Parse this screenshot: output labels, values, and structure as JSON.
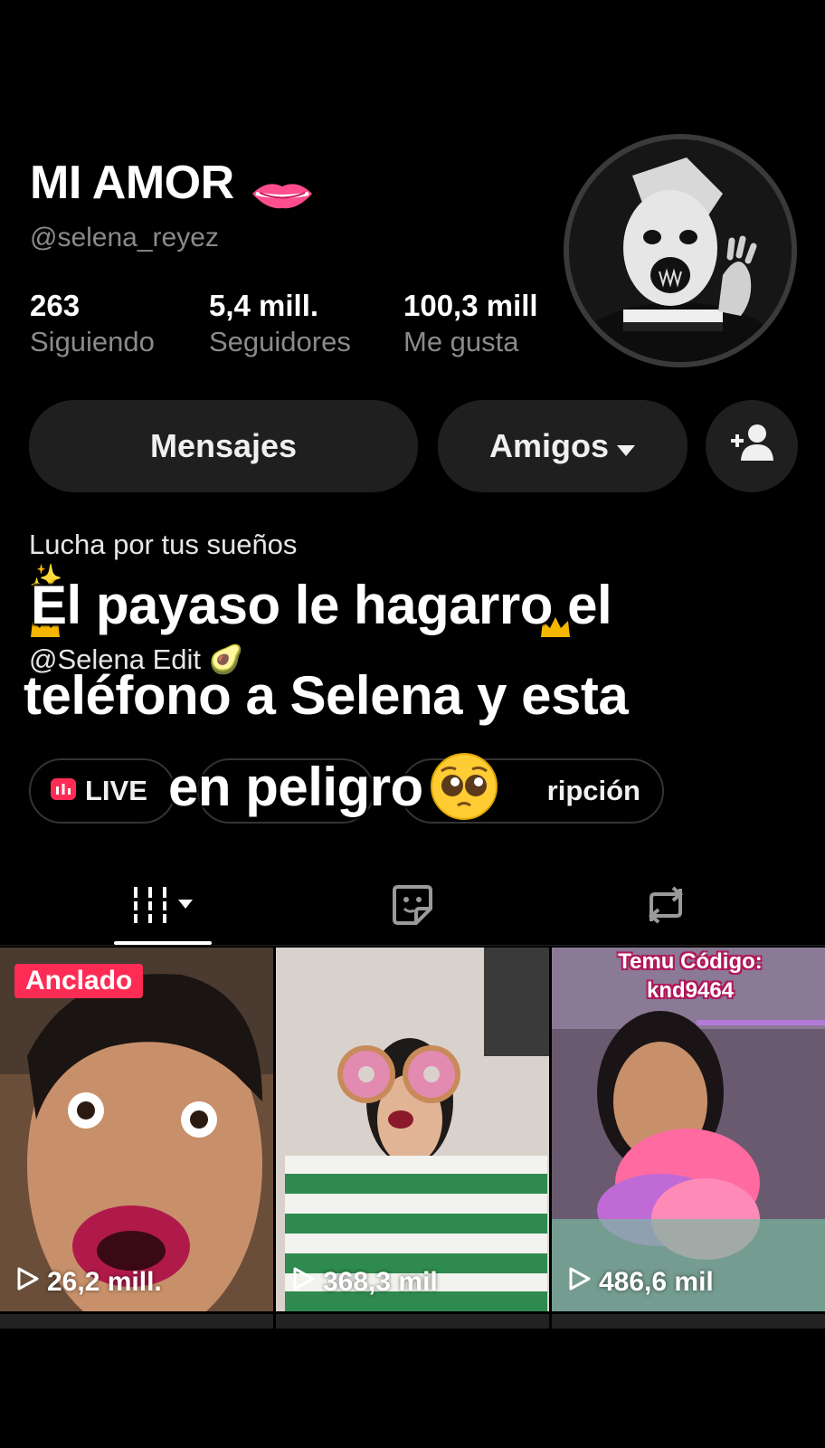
{
  "profile": {
    "display_name": "MI AMOR",
    "name_emoji": "lips-icon",
    "username": "@selena_reyez",
    "stats": [
      {
        "value": "263",
        "label": "Siguiendo"
      },
      {
        "value": "5,4 mill.",
        "label": "Seguidores"
      },
      {
        "value": "100,3 mill",
        "label": "Me gusta"
      }
    ]
  },
  "actions": {
    "messages_label": "Mensajes",
    "friends_label": "Amigos"
  },
  "bio": {
    "line1": "Lucha por tus sueños",
    "line2": "✨",
    "line3": "@Selena Edit 🥑",
    "line4": ""
  },
  "chips": {
    "live_label": "LIVE",
    "subscription_label": "ripción"
  },
  "caption": {
    "line1": "El payaso le hagarro el",
    "line2": "teléfono a Selena y esta",
    "line3": "en peligro"
  },
  "tabs": [
    {
      "name": "videos",
      "icon": "grid-icon"
    },
    {
      "name": "liked",
      "icon": "sticker-icon"
    },
    {
      "name": "reposts",
      "icon": "repost-icon"
    }
  ],
  "videos": [
    {
      "views": "26,2 mill.",
      "pinned_label": "Anclado"
    },
    {
      "views": "368,3 mil"
    },
    {
      "views": "486,6 mil",
      "overlay_line1": "Temu Código:",
      "overlay_line2": "knd9464"
    }
  ],
  "colors": {
    "background": "#000000",
    "pill": "#1f1f1f",
    "muted_text": "#8a8a8a",
    "pinned": "#fe2c55",
    "live": "#fe2c55"
  }
}
